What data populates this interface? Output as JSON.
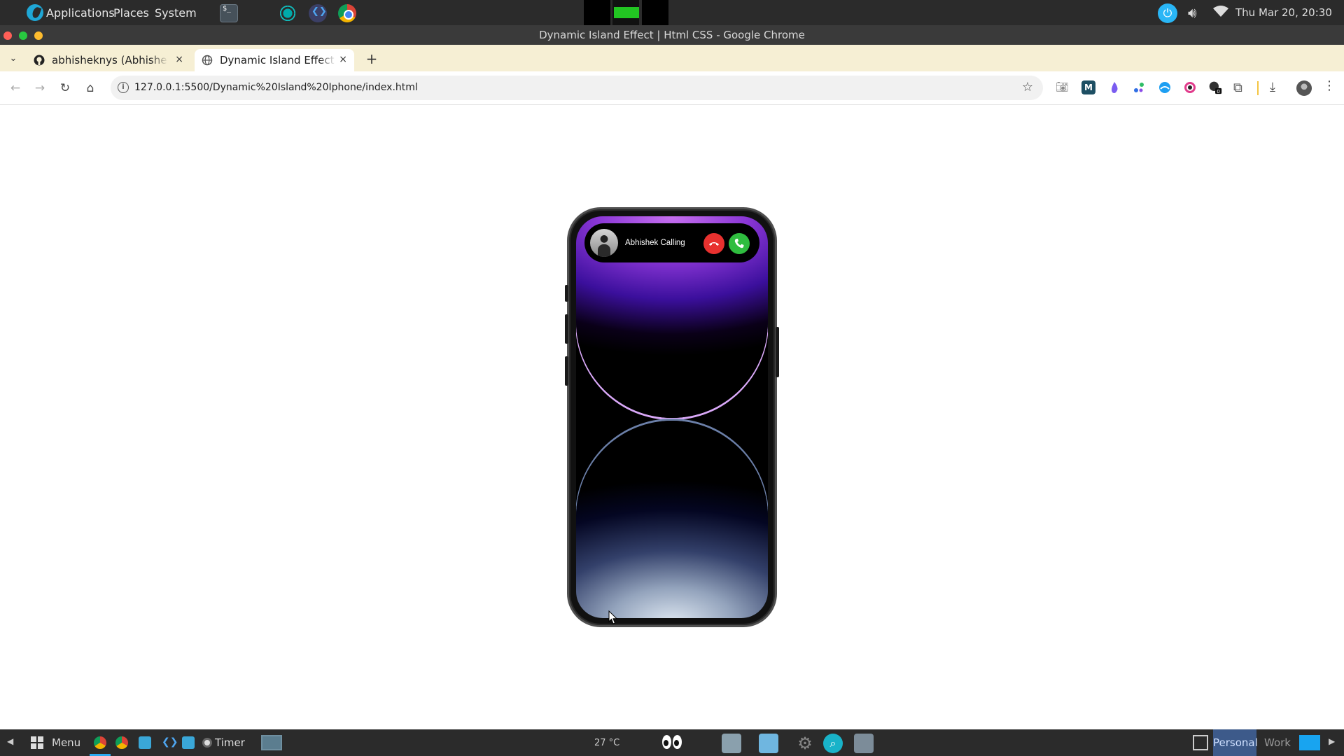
{
  "top_panel": {
    "menus": [
      "Applications",
      "Places",
      "System"
    ],
    "clock": "Thu Mar 20, 20:30",
    "launchers": [
      "terminal-icon",
      "screenshot-icon",
      "vscode-icon",
      "chrome-icon"
    ],
    "status_icons": [
      "power-icon",
      "volume-icon",
      "wifi-icon"
    ]
  },
  "window": {
    "title": "Dynamic Island Effect | Html CSS - Google Chrome"
  },
  "tabs": [
    {
      "title": "abhisheknys (Abhishek P",
      "icon": "github-icon",
      "close": "×"
    },
    {
      "title": "Dynamic Island Effect | H",
      "icon": "globe-icon",
      "close": "×"
    }
  ],
  "tabstrip": {
    "new_tab": "+",
    "tab_search": "⌄"
  },
  "toolbar": {
    "url": "127.0.0.1:5500/Dynamic%20Island%20Iphone/index.html",
    "back": "←",
    "forward": "→",
    "reload": "↻",
    "home": "⌂",
    "star": "☆",
    "extension_badge": "0",
    "download": "⤓",
    "menu": "⋮"
  },
  "page": {
    "island": {
      "caller_text": "Abhishek Calling",
      "decline_color": "#e8312f",
      "accept_color": "#2fbd3f"
    },
    "wallpaper": {
      "top_accent": "#8a36d6",
      "bottom_accent": "#93a3bc"
    }
  },
  "taskbar": {
    "menu_label": "Menu",
    "timer_label": "Timer",
    "weather": "27 °C",
    "workspaces": [
      "Personal",
      "Work"
    ]
  }
}
